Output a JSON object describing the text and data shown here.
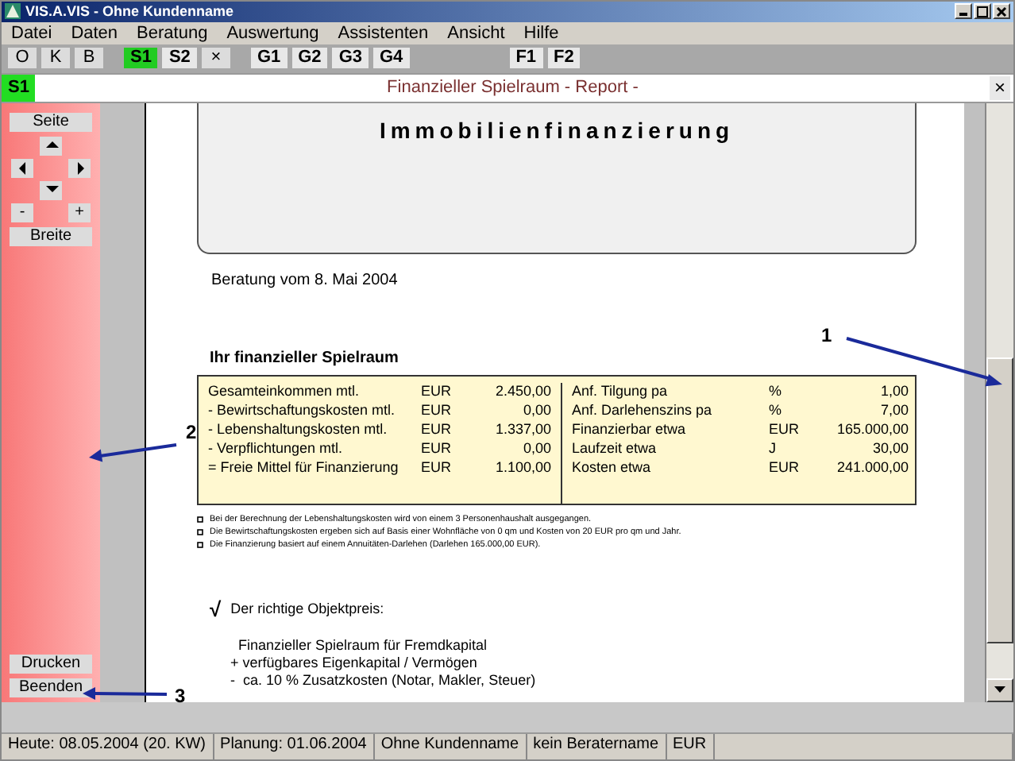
{
  "window": {
    "title": "VIS.A.VIS - Ohne Kundenname"
  },
  "menu": [
    {
      "label": "Datei"
    },
    {
      "label": "Daten"
    },
    {
      "label": "Beratung"
    },
    {
      "label": "Auswertung"
    },
    {
      "label": "Assistenten"
    },
    {
      "label": "Ansicht"
    },
    {
      "label": "Hilfe"
    }
  ],
  "toolbar": [
    {
      "label": "O",
      "kind": "plain",
      "selected": false
    },
    {
      "label": "K",
      "kind": "plain",
      "selected": false
    },
    {
      "label": "B",
      "kind": "plain",
      "selected": false
    },
    {
      "label": "S1",
      "kind": "bold",
      "selected": true
    },
    {
      "label": "S2",
      "kind": "bold",
      "selected": false
    },
    {
      "label": "×",
      "kind": "plain",
      "selected": false
    },
    {
      "label": "G1",
      "kind": "bold",
      "selected": false
    },
    {
      "label": "G2",
      "kind": "bold",
      "selected": false
    },
    {
      "label": "G3",
      "kind": "bold",
      "selected": false
    },
    {
      "label": "G4",
      "kind": "bold",
      "selected": false
    },
    {
      "label": "F1",
      "kind": "bold",
      "selected": false
    },
    {
      "label": "F2",
      "kind": "bold",
      "selected": false
    }
  ],
  "report_header": {
    "tag": "S1",
    "title": "Finanzieller Spielraum - Report -",
    "close": "×"
  },
  "side_panel": {
    "page_button": "Seite",
    "zoom_out": "-",
    "zoom_in": "+",
    "width_button": "Breite",
    "print_button": "Drucken",
    "exit_button": "Beenden"
  },
  "report": {
    "title": "Immobilienfinanzierung",
    "date_line": "Beratung vom 8. Mai 2004",
    "section_title": "Ihr finanzieller Spielraum",
    "left_rows": [
      {
        "label": "Gesamteinkommen mtl.",
        "unit": "EUR",
        "value": "2.450,00"
      },
      {
        "label": "- Bewirtschaftungskosten mtl.",
        "unit": "EUR",
        "value": "0,00"
      },
      {
        "label": "- Lebenshaltungskosten mtl.",
        "unit": "EUR",
        "value": "1.337,00"
      },
      {
        "label": "- Verpflichtungen mtl.",
        "unit": "EUR",
        "value": "0,00"
      },
      {
        "label": "= Freie Mittel für Finanzierung",
        "unit": "EUR",
        "value": "1.100,00"
      }
    ],
    "right_rows": [
      {
        "label": "Anf. Tilgung pa",
        "unit": "%",
        "value": "1,00"
      },
      {
        "label": "Anf. Darlehenszins pa",
        "unit": "%",
        "value": "7,00"
      },
      {
        "label": "Finanzierbar etwa",
        "unit": "EUR",
        "value": "165.000,00"
      },
      {
        "label": "Laufzeit etwa",
        "unit": "J",
        "value": "30,00"
      },
      {
        "label": "Kosten etwa",
        "unit": "EUR",
        "value": "241.000,00"
      }
    ],
    "notes": [
      "Bei der Berechnung der Lebenshaltungskosten wird von einem 3 Personenhaushalt ausgegangen.",
      "Die Bewirtschaftungskosten ergeben sich auf Basis einer Wohnfläche von 0 qm und Kosten von 20 EUR pro qm und Jahr.",
      "Die Finanzierung basiert auf einem Annuitäten-Darlehen   (Darlehen 165.000,00 EUR)."
    ],
    "check_mark": "√",
    "check_item": "Der richtige Objektpreis:",
    "calc_lines": [
      "  Finanzieller Spielraum für Fremdkapital",
      "+ verfügbares Eigenkapital / Vermögen",
      "-  ca. 10 % Zusatzkosten (Notar, Makler, Steuer)"
    ]
  },
  "status_bar": [
    "Heute: 08.05.2004 (20. KW)",
    "Planung: 01.06.2004",
    "Ohne Kundenname",
    "kein Beratername",
    "EUR"
  ],
  "annotations": [
    "1",
    "2",
    "3"
  ]
}
